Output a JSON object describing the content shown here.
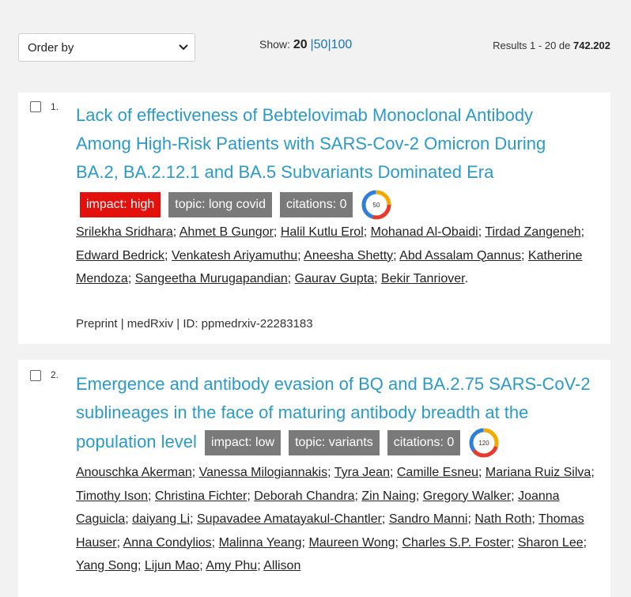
{
  "toolbar": {
    "order_label": "Order by",
    "show_label": "Show:",
    "show_current": "20",
    "show_opt1": "50",
    "show_opt2": "100",
    "sep": "|",
    "results_prefix": "Results 1 - 20 de",
    "results_total": "742.202"
  },
  "articles": [
    {
      "num": "1.",
      "title": "Lack of effectiveness of Bebtelovimab Monoclonal Antibody Among High-Risk Patients with SARS-Cov-2 Omicron During BA.2, BA.2.12.1 and BA.5 Subvariants Dominated Era",
      "badge_impact": "impact: high",
      "badge_topic": "topic: long covid",
      "badge_citations": "citations: 0",
      "altmetric": "50",
      "authors": [
        "Srilekha Sridhara",
        "Ahmet B Gungor",
        "Halil Kutlu Erol",
        "Mohanad Al-Obaidi",
        "Tirdad Zangeneh",
        "Edward Bedrick",
        "Venkatesh Ariyamuthu",
        "Aneesha Shetty",
        "Abd Assalam Qannus",
        "Katherine Mendoza",
        "Sangeetha Murugapandian",
        "Gaurav Gupta",
        "Bekir Tanriover"
      ],
      "meta": "Preprint | medRxiv | ID: ppmedrxiv-22283183"
    },
    {
      "num": "2.",
      "title": "Emergence and antibody evasion of BQ and BA.2.75 SARS-CoV-2 sublineages in the face of maturing antibody breadth at the population level",
      "badge_impact": "impact: low",
      "badge_topic": "topic: variants",
      "badge_citations": "citations: 0",
      "altmetric": "120",
      "authors": [
        "Anouschka Akerman",
        "Vanessa Milogiannakis",
        "Tyra Jean",
        "Camille Esneu",
        "Mariana Ruiz Silva",
        "Timothy Ison",
        "Christina Fichter",
        "Deborah Chandra",
        "Zin Naing",
        "Gregory Walker",
        "Joanna Caguicla",
        "daiyang Li",
        "Supavadee Amatayakul-Chantler",
        "Sandro Manni",
        "Nath Roth",
        "Thomas Hauser",
        "Anna Condylios",
        "Malinna Yeang",
        "Maureen Wong",
        "Charles S.P. Foster",
        "Sharon Lee",
        "Yang Song",
        "Lijun Mao",
        "Amy Phu",
        "Allison"
      ]
    }
  ]
}
